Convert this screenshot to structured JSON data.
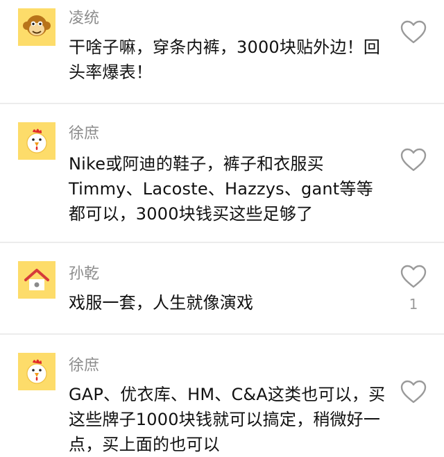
{
  "comments": [
    {
      "username": "凌统",
      "avatar_icon": "monkey-avatar-icon",
      "content": "干啥子嘛，穿条内裤，3000块贴外边！回头率爆表！",
      "like_count": ""
    },
    {
      "username": "徐庶",
      "avatar_icon": "chicken-avatar-icon",
      "content": "Nike或阿迪的鞋子，裤子和衣服买Timmy、Lacoste、Hazzys、gant等等都可以，3000块钱买这些足够了",
      "like_count": ""
    },
    {
      "username": "孙乾",
      "avatar_icon": "house-avatar-icon",
      "content": "戏服一套，人生就像演戏",
      "like_count": "1"
    },
    {
      "username": "徐庶",
      "avatar_icon": "chicken-avatar-icon",
      "content": "GAP、优衣库、HM、C&A这类也可以，买这些牌子1000块钱就可以搞定，稍微好一点，买上面的也可以",
      "like_count": ""
    }
  ],
  "colors": {
    "avatar_bg": "#fddc6a",
    "username": "#8c8c8c",
    "text": "#111111",
    "divider": "#ececec",
    "heart_stroke": "#9a9a9a"
  }
}
